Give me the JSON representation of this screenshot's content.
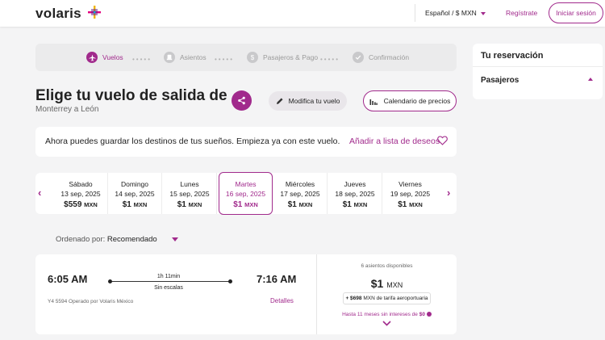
{
  "header": {
    "logo": "volaris",
    "language": "Español / $ MXN",
    "register": "Regístrate",
    "login": "Iniciar sesión"
  },
  "progress": {
    "steps": [
      {
        "label": "Vuelos",
        "active": true
      },
      {
        "label": "Asientos",
        "active": false
      },
      {
        "label": "Pasajeros & Pago",
        "active": false
      },
      {
        "label": "Confirmación",
        "active": false
      }
    ]
  },
  "main": {
    "title": "Elige tu vuelo de salida de",
    "subtitle": "Monterrey a León",
    "modify_label": "Modifica tu vuelo",
    "calendar_label": "Calendario de precios"
  },
  "wishlist": {
    "text": "Ahora puedes guardar los destinos de tus sueños. Empieza ya con este vuelo.",
    "link": "Añadir a lista de deseos"
  },
  "dates": [
    {
      "day": "Sábado",
      "date": "13 sep, 2025",
      "price": "$559",
      "currency": "MXN",
      "selected": false
    },
    {
      "day": "Domingo",
      "date": "14 sep, 2025",
      "price": "$1",
      "currency": "MXN",
      "selected": false
    },
    {
      "day": "Lunes",
      "date": "15 sep, 2025",
      "price": "$1",
      "currency": "MXN",
      "selected": false
    },
    {
      "day": "Martes",
      "date": "16 sep, 2025",
      "price": "$1",
      "currency": "MXN",
      "selected": true
    },
    {
      "day": "Miércoles",
      "date": "17 sep, 2025",
      "price": "$1",
      "currency": "MXN",
      "selected": false
    },
    {
      "day": "Jueves",
      "date": "18 sep, 2025",
      "price": "$1",
      "currency": "MXN",
      "selected": false
    },
    {
      "day": "Viernes",
      "date": "19 sep, 2025",
      "price": "$1",
      "currency": "MXN",
      "selected": false
    }
  ],
  "sort": {
    "label": "Ordenado por:",
    "value": "Recomendado"
  },
  "flight": {
    "departure": "6:05 AM",
    "arrival": "7:16 AM",
    "duration": "1h 11min",
    "stops": "Sin escalas",
    "operator": "Y4 5594 Operado por Volaris México",
    "details": "Detalles",
    "seats": "6 asientos disponibles",
    "price": "$1",
    "currency": "MXN",
    "tax_amount": "+ $698",
    "tax_text": "MXN de tarifa aeroportuaria",
    "installments_text": "Hasta 11 meses sin intereses de",
    "installments_amount": "$0"
  },
  "sidebar": {
    "title": "Tu reservación",
    "passengers": "Pasajeros"
  },
  "colors": {
    "brand": "#a12a8c",
    "background": "#f4f4f5"
  }
}
